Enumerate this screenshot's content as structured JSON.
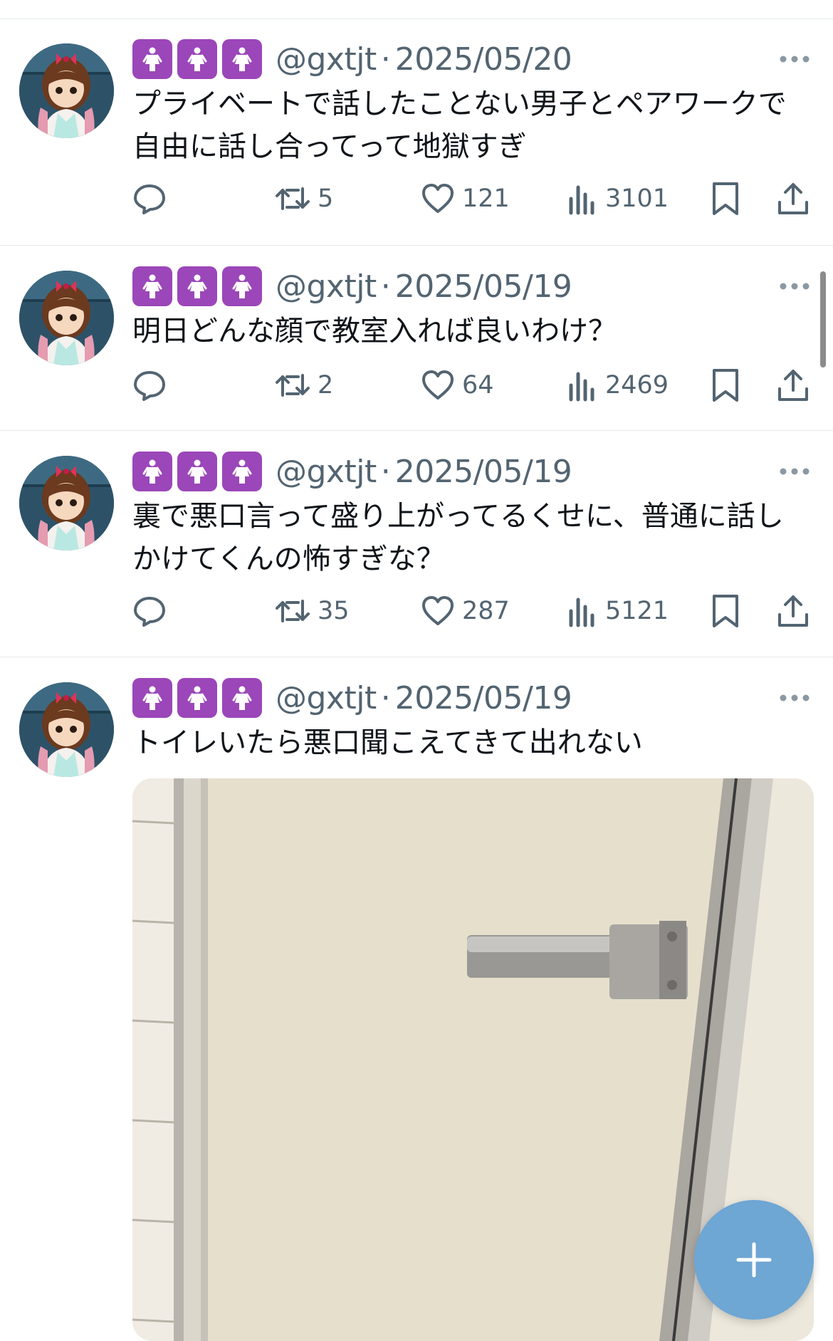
{
  "tweets": [
    {
      "handle": "@gxtjt",
      "separator": "·",
      "date": "2025/05/20",
      "text": "プライベートで話したことない男子とペアワークで自由に話し合ってって地獄すぎ",
      "retweets": "5",
      "likes": "121",
      "views": "3101"
    },
    {
      "handle": "@gxtjt",
      "separator": "·",
      "date": "2025/05/19",
      "text": "明日どんな顔で教室入れば良いわけ？",
      "retweets": "2",
      "likes": "64",
      "views": "2469"
    },
    {
      "handle": "@gxtjt",
      "separator": "·",
      "date": "2025/05/19",
      "text": "裏で悪口言って盛り上がってるくせに、普通に話しかけてくんの怖すぎな？",
      "retweets": "35",
      "likes": "287",
      "views": "5121"
    },
    {
      "handle": "@gxtjt",
      "separator": "·",
      "date": "2025/05/19",
      "text": "トイレいたら悪口聞こえてきて出れない"
    }
  ],
  "icons": {
    "badge": "woman-emoji-icon",
    "more": "more-dots-icon",
    "reply": "reply-icon",
    "retweet": "retweet-icon",
    "like": "heart-icon",
    "views": "views-bar-icon",
    "bookmark": "bookmark-icon",
    "share": "share-icon",
    "compose": "plus-icon"
  },
  "colors": {
    "badge": "#9b46b9",
    "muted_text": "#536471",
    "fab": "#6ea6d4"
  }
}
